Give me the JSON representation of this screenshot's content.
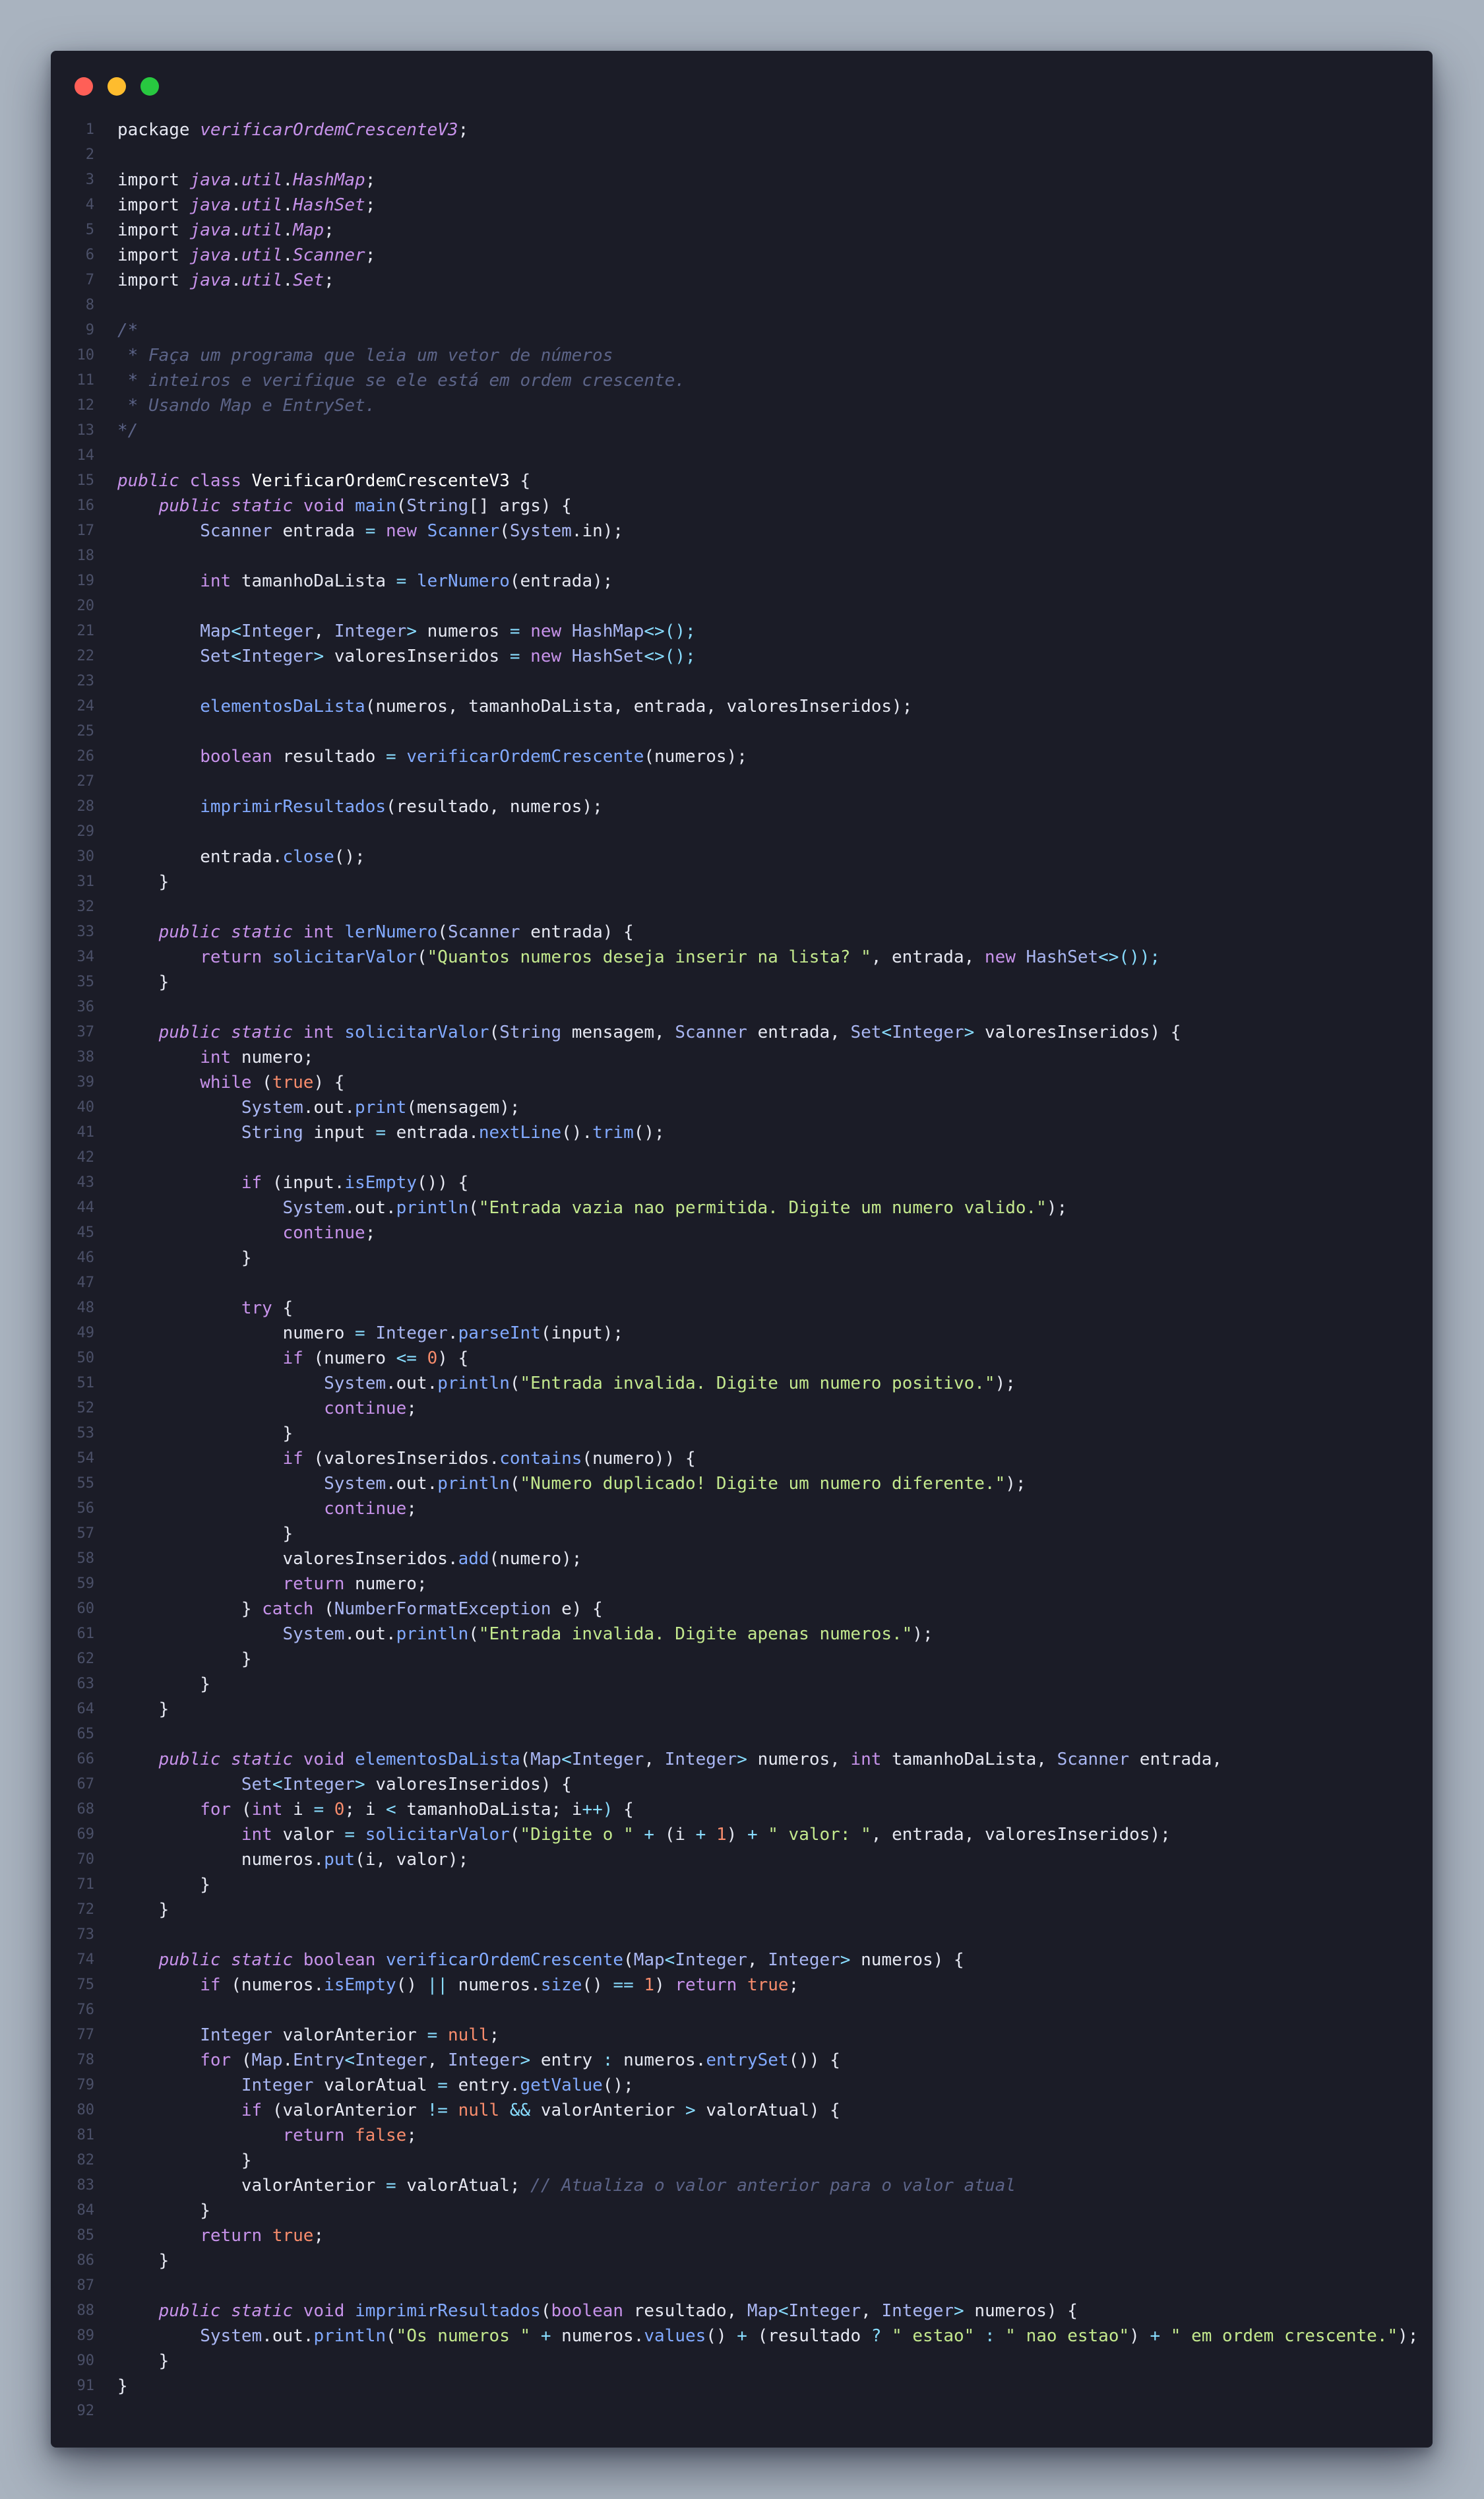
{
  "window": {
    "controls": [
      "close",
      "minimize",
      "zoom"
    ],
    "colors": {
      "close": "#ff5f57",
      "minimize": "#febc2e",
      "zoom": "#28c840",
      "background": "#1b1c27"
    }
  },
  "code": {
    "lines": [
      "package verificarOrdemCrescenteV3;",
      "",
      "import java.util.HashMap;",
      "import java.util.HashSet;",
      "import java.util.Map;",
      "import java.util.Scanner;",
      "import java.util.Set;",
      "",
      "/*",
      " * Faça um programa que leia um vetor de números",
      " * inteiros e verifique se ele está em ordem crescente.",
      " * Usando Map e EntrySet.",
      "*/",
      "",
      "public class VerificarOrdemCrescenteV3 {",
      "    public static void main(String[] args) {",
      "        Scanner entrada = new Scanner(System.in);",
      "",
      "        int tamanhoDaLista = lerNumero(entrada);",
      "",
      "        Map<Integer, Integer> numeros = new HashMap<>();",
      "        Set<Integer> valoresInseridos = new HashSet<>();",
      "",
      "        elementosDaLista(numeros, tamanhoDaLista, entrada, valoresInseridos);",
      "",
      "        boolean resultado = verificarOrdemCrescente(numeros);",
      "",
      "        imprimirResultados(resultado, numeros);",
      "",
      "        entrada.close();",
      "    }",
      "",
      "    public static int lerNumero(Scanner entrada) {",
      "        return solicitarValor(\"Quantos numeros deseja inserir na lista? \", entrada, new HashSet<>());",
      "    }",
      "",
      "    public static int solicitarValor(String mensagem, Scanner entrada, Set<Integer> valoresInseridos) {",
      "        int numero;",
      "        while (true) {",
      "            System.out.print(mensagem);",
      "            String input = entrada.nextLine().trim();",
      "",
      "            if (input.isEmpty()) {",
      "                System.out.println(\"Entrada vazia nao permitida. Digite um numero valido.\");",
      "                continue;",
      "            }",
      "",
      "            try {",
      "                numero = Integer.parseInt(input);",
      "                if (numero <= 0) {",
      "                    System.out.println(\"Entrada invalida. Digite um numero positivo.\");",
      "                    continue;",
      "                }",
      "                if (valoresInseridos.contains(numero)) {",
      "                    System.out.println(\"Numero duplicado! Digite um numero diferente.\");",
      "                    continue;",
      "                }",
      "                valoresInseridos.add(numero);",
      "                return numero;",
      "            } catch (NumberFormatException e) {",
      "                System.out.println(\"Entrada invalida. Digite apenas numeros.\");",
      "            }",
      "        }",
      "    }",
      "",
      "    public static void elementosDaLista(Map<Integer, Integer> numeros, int tamanhoDaLista, Scanner entrada,",
      "            Set<Integer> valoresInseridos) {",
      "        for (int i = 0; i < tamanhoDaLista; i++) {",
      "            int valor = solicitarValor(\"Digite o \" + (i + 1) + \" valor: \", entrada, valoresInseridos);",
      "            numeros.put(i, valor);",
      "        }",
      "    }",
      "",
      "    public static boolean verificarOrdemCrescente(Map<Integer, Integer> numeros) {",
      "        if (numeros.isEmpty() || numeros.size() == 1) return true;",
      "",
      "        Integer valorAnterior = null;",
      "        for (Map.Entry<Integer, Integer> entry : numeros.entrySet()) {",
      "            Integer valorAtual = entry.getValue();",
      "            if (valorAnterior != null && valorAnterior > valorAtual) {",
      "                return false;",
      "            }",
      "            valorAnterior = valorAtual; // Atualiza o valor anterior para o valor atual",
      "        }",
      "        return true;",
      "    }",
      "",
      "    public static void imprimirResultados(boolean resultado, Map<Integer, Integer> numeros) {",
      "        System.out.println(\"Os numeros \" + numeros.values() + (resultado ? \" estao\" : \" nao estao\") + \" em ordem crescente.\");",
      "    }",
      "}",
      ""
    ]
  },
  "theme": {
    "keyword": "#c792ea",
    "type": "#a9b6f2",
    "function": "#82aaff",
    "string": "#c3e88d",
    "number": "#f78c6c",
    "parameter": "#ffcb6b",
    "comment": "#5c6488",
    "operator": "#89ddff",
    "text": "#e6e8f2",
    "line_number": "#4b5068"
  }
}
